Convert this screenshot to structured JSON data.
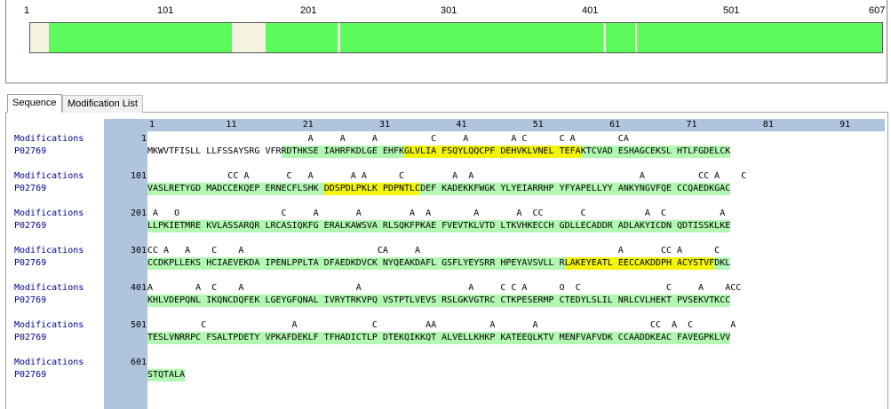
{
  "coverage": {
    "scale_labels": [
      "1",
      "101",
      "201",
      "301",
      "401",
      "501",
      "607"
    ],
    "sequence_length": 607,
    "covered_ranges": [
      [
        14,
        35
      ],
      [
        36,
        144
      ],
      [
        169,
        219
      ],
      [
        222,
        408
      ],
      [
        411,
        431
      ],
      [
        433,
        607
      ]
    ]
  },
  "tabs": [
    {
      "label": "Sequence",
      "active": true
    },
    {
      "label": "Modification List",
      "active": false
    }
  ],
  "ruler": [
    "1",
    "11",
    "21",
    "31",
    "41",
    "51",
    "61",
    "71",
    "81",
    "91"
  ],
  "rows": [
    {
      "mod_label": "Modifications",
      "num": "1",
      "protein": "P02769",
      "mods": "                              A     A     A          C     A        A C      C A        CA",
      "segments": [
        {
          "t": "MKWVTFISLL LLFSSAYSRG VFR",
          "c": ""
        },
        {
          "t": "RDTHKSE IAHRFKDLGE EHFK",
          "c": "cov"
        },
        {
          "t": "GLVLIA FSQYLQQCPF DEHVKLVNEL TEFA",
          "c": "hl"
        },
        {
          "t": "KTCVAD ESHAGCEKSL HTLFGDELCK",
          "c": "cov"
        }
      ]
    },
    {
      "mod_label": "Modifications",
      "num": "101",
      "protein": "P02769",
      "mods": "               CC A       C   A       A A      C         A  A                               A          CC A    C",
      "segments": [
        {
          "t": "VASLRETYGD MADCCEKQEP ERNECFLSHK ",
          "c": "cov"
        },
        {
          "t": "DDSPDLPKLK PDPNTLC",
          "c": "hl"
        },
        {
          "t": "DEF KADEKKFWGK YLYEIARRHP YFYAPELLYY ANKYNGVFQE CCQAEDKGAC",
          "c": "cov"
        }
      ]
    },
    {
      "mod_label": "Modifications",
      "num": "201",
      "protein": "P02769",
      "mods": " A   O                   C     A       A         A  A        A       A  CC       C           A  C          A",
      "segments": [
        {
          "t": "LLPKIETMRE KVLASSARQR LRCASIQKFG ERALKAWSVA RLSQKFPKAE FVEVTKLVTD LTKVHKECCH GDLLECADDR ADLAKYICDN QDTISSKLKE",
          "c": "cov"
        }
      ]
    },
    {
      "mod_label": "Modifications",
      "num": "301",
      "protein": "P02769",
      "mods": "CC A   A    C    A                         CA     A                                     A       CC A      C",
      "segments": [
        {
          "t": "CCDKPLLEKS HCIAEVEKDA IPENLPPLTA DFAEDKDVCK NYQEAKDAFL GSFLYEYSRR HPEYAVSVLL R",
          "c": "cov"
        },
        {
          "t": "LAKEYEATL EECCAKDDPH ACYSTVF",
          "c": "hl"
        },
        {
          "t": "DKL",
          "c": "cov"
        }
      ]
    },
    {
      "mod_label": "Modifications",
      "num": "401",
      "protein": "P02769",
      "mods": "A        A  C    A                     A                    A     C C A      O  C                C     A    ACC",
      "segments": [
        {
          "t": "KHLVDEPQNL IKQNCDQFEK LGEYGFQNAL IVRYTRKVPQ VSTPTLVEVS RSLGKVGTRC CTKPESERMP CTEDYLSLIL NRLCVLHEKT PVSEKVTKCC",
          "c": "cov"
        }
      ]
    },
    {
      "mod_label": "Modifications",
      "num": "501",
      "protein": "P02769",
      "mods": "          C                A              C         AA          A       A                     CC  A  C       A",
      "segments": [
        {
          "t": "TESLVNRRPC FSALTPDETY VPKAFDEKLF TFHADICTLP DTEKQIKKQT ALVELLKHKP KATEEQLKTV MENFVAFVDK CCAADDKEAC FAVEGPKLVV",
          "c": "cov"
        }
      ]
    },
    {
      "mod_label": "Modifications",
      "num": "601",
      "protein": "P02769",
      "mods": "",
      "segments": [
        {
          "t": "STQTALA",
          "c": "cov"
        }
      ]
    }
  ]
}
